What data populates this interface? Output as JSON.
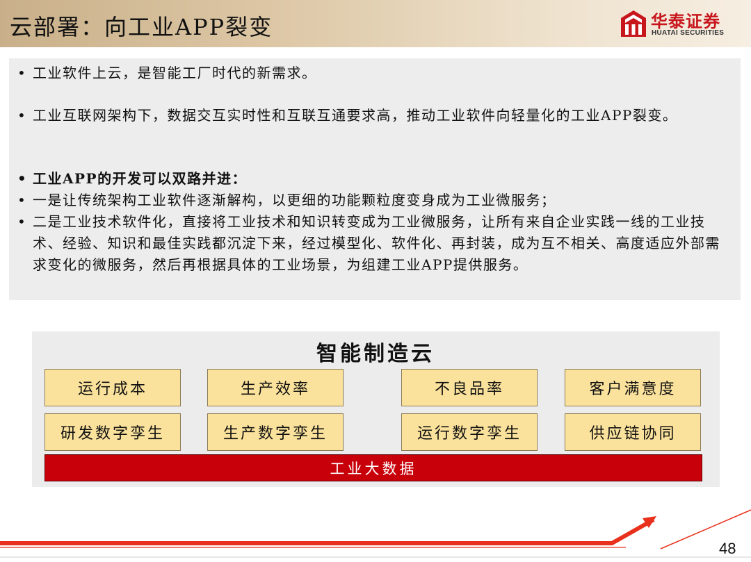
{
  "header": {
    "title": "云部署：向工业APP裂变",
    "logo": {
      "cn": "华泰证券",
      "en": "HUATAI SECURITIES",
      "brand_color": "#c8161d"
    }
  },
  "content": {
    "bullets": [
      "工业软件上云，是智能工厂时代的新需求。",
      "工业互联网架构下，数据交互实时性和互联互通要求高，推动工业软件向轻量化的工业APP裂变。",
      "工业APP的开发可以双路并进：",
      "一是让传统架构工业软件逐渐解构，以更细的功能颗粒度变身成为工业微服务；",
      "二是工业技术软件化，直接将工业技术和知识转变成为工业微服务，让所有来自企业实践一线的工业技术、经验、知识和最佳实践都沉淀下来，经过模型化、软件化、再封装，成为互不相关、高度适应外部需求变化的微服务，然后再根据具体的工业场景，为组建工业APP提供服务。"
    ],
    "bullet_symbol": "•"
  },
  "diagram": {
    "title": "智能制造云",
    "row1": [
      "运行成本",
      "生产效率",
      "不良品率",
      "客户满意度"
    ],
    "row2": [
      "研发数字孪生",
      "生产数字孪生",
      "运行数字孪生",
      "供应链协同"
    ],
    "base": "工业大数据",
    "colors": {
      "box": "#fbe29c",
      "base": "#c8000a"
    }
  },
  "footer": {
    "page_number": "48",
    "accent": "#e8301c"
  }
}
